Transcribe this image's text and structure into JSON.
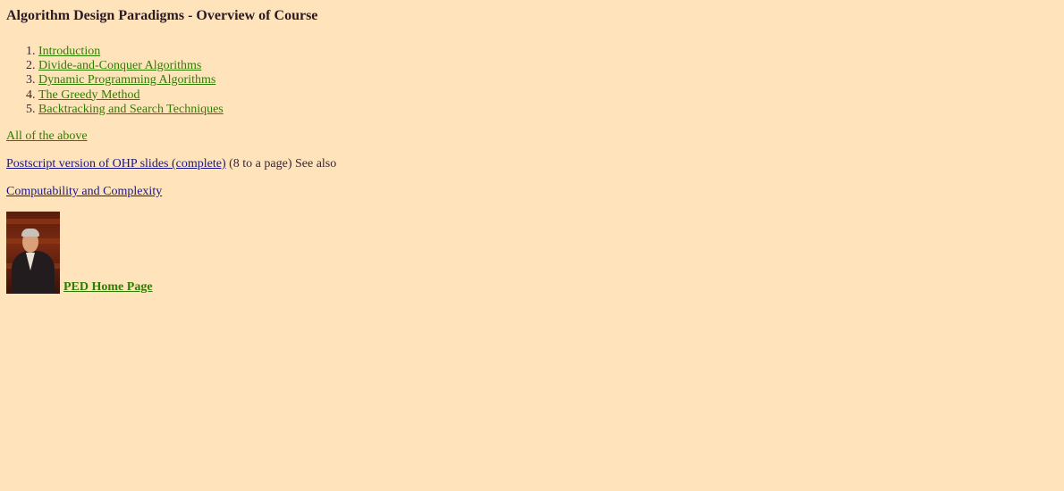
{
  "page": {
    "title": "Algorithm Design Paradigms - Overview of Course"
  },
  "contents": {
    "items": [
      {
        "label": "Introduction"
      },
      {
        "label": "Divide-and-Conquer Algorithms"
      },
      {
        "label": "Dynamic Programming Algorithms"
      },
      {
        "label": "The Greedy Method"
      },
      {
        "label": "Backtracking and Search Techniques"
      }
    ]
  },
  "links": {
    "all_above": "All of the above",
    "postscript_link": "Postscript version of OHP slides (complete)",
    "postscript_suffix": " (8 to a page) See also",
    "complexity": "Computability and Complexity",
    "home": "PED Home Page"
  },
  "colors": {
    "background": "#FFE4BB",
    "link_green": "#2e7d00",
    "link_blue": "#1a148a"
  },
  "icons": {
    "portrait": "author-portrait-photo"
  }
}
